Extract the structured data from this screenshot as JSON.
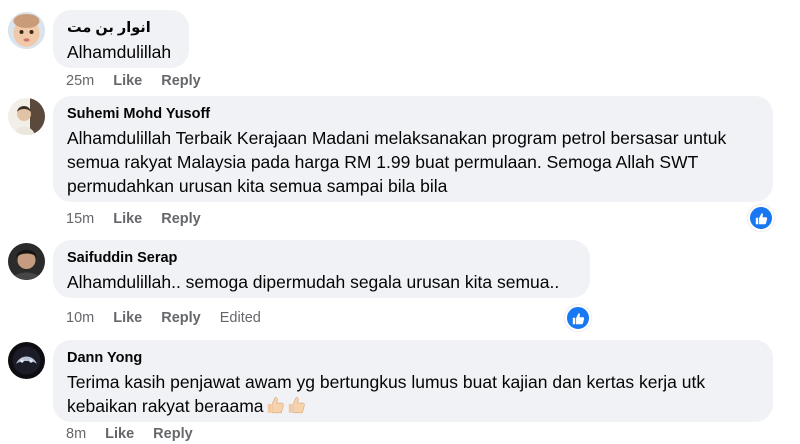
{
  "comments": [
    {
      "author": "انوار بن مت",
      "text": "Alhamdulillah",
      "time": "25m",
      "like_label": "Like",
      "reply_label": "Reply",
      "has_reaction": false
    },
    {
      "author": "Suhemi Mohd Yusoff",
      "text_lines": [
        "Alhamdulillah Terbaik Kerajaan Madani melaksanakan program petrol bersasar untuk",
        "semua rakyat Malaysia pada harga RM 1.99 buat permulaan. Semoga Allah SWT",
        "permudahkan urusan kita semua sampai bila bila"
      ],
      "time": "15m",
      "like_label": "Like",
      "reply_label": "Reply",
      "has_reaction": true
    },
    {
      "author": "Saifuddin Serap",
      "text": "Alhamdulillah.. semoga dipermudah segala urusan kita semua..",
      "time": "10m",
      "like_label": "Like",
      "reply_label": "Reply",
      "edited_label": "Edited",
      "has_reaction": true
    },
    {
      "author": "Dann Yong",
      "text_lines": [
        "Terima kasih penjawat awam yg bertungkus lumus buat kajian dan kertas kerja utk",
        "kebaikan rakyat beraama"
      ],
      "emojis": [
        "thumbs-up-light-skin-tone",
        "thumbs-up-light-skin-tone"
      ],
      "time": "8m",
      "like_label": "Like",
      "reply_label": "Reply",
      "has_reaction": false
    }
  ],
  "colors": {
    "bubble": "#f0f2f5",
    "meta_text": "#65676b",
    "reaction_blue": "#1877f2"
  }
}
